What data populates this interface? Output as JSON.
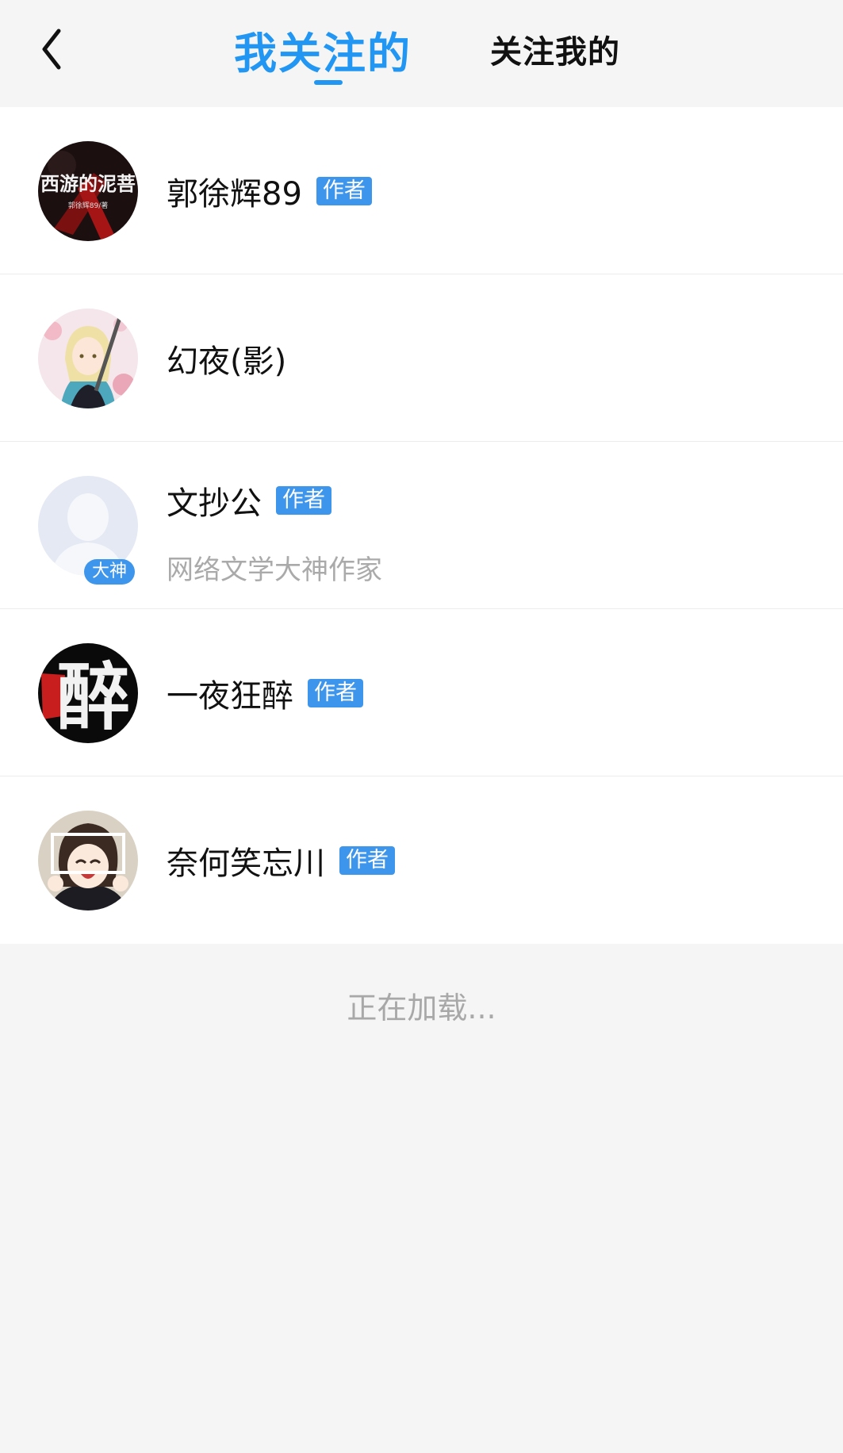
{
  "header": {
    "tabs": [
      {
        "label": "我关注的",
        "active": true
      },
      {
        "label": "关注我的",
        "active": false
      }
    ],
    "accent_color": "#2196f3"
  },
  "follows": [
    {
      "name": "郭徐辉89",
      "badge": "作者",
      "avatar_text": "西游的泥菩",
      "avatar_subtext": "郭徐辉89/著"
    },
    {
      "name": "幻夜(影)"
    },
    {
      "name": "文抄公",
      "badge": "作者",
      "subtitle": "网络文学大神作家",
      "avatar_badge": "大神"
    },
    {
      "name": "一夜狂醉",
      "badge": "作者",
      "avatar_text": "醉"
    },
    {
      "name": "奈何笑忘川",
      "badge": "作者"
    }
  ],
  "status": {
    "loading": "正在加载..."
  }
}
